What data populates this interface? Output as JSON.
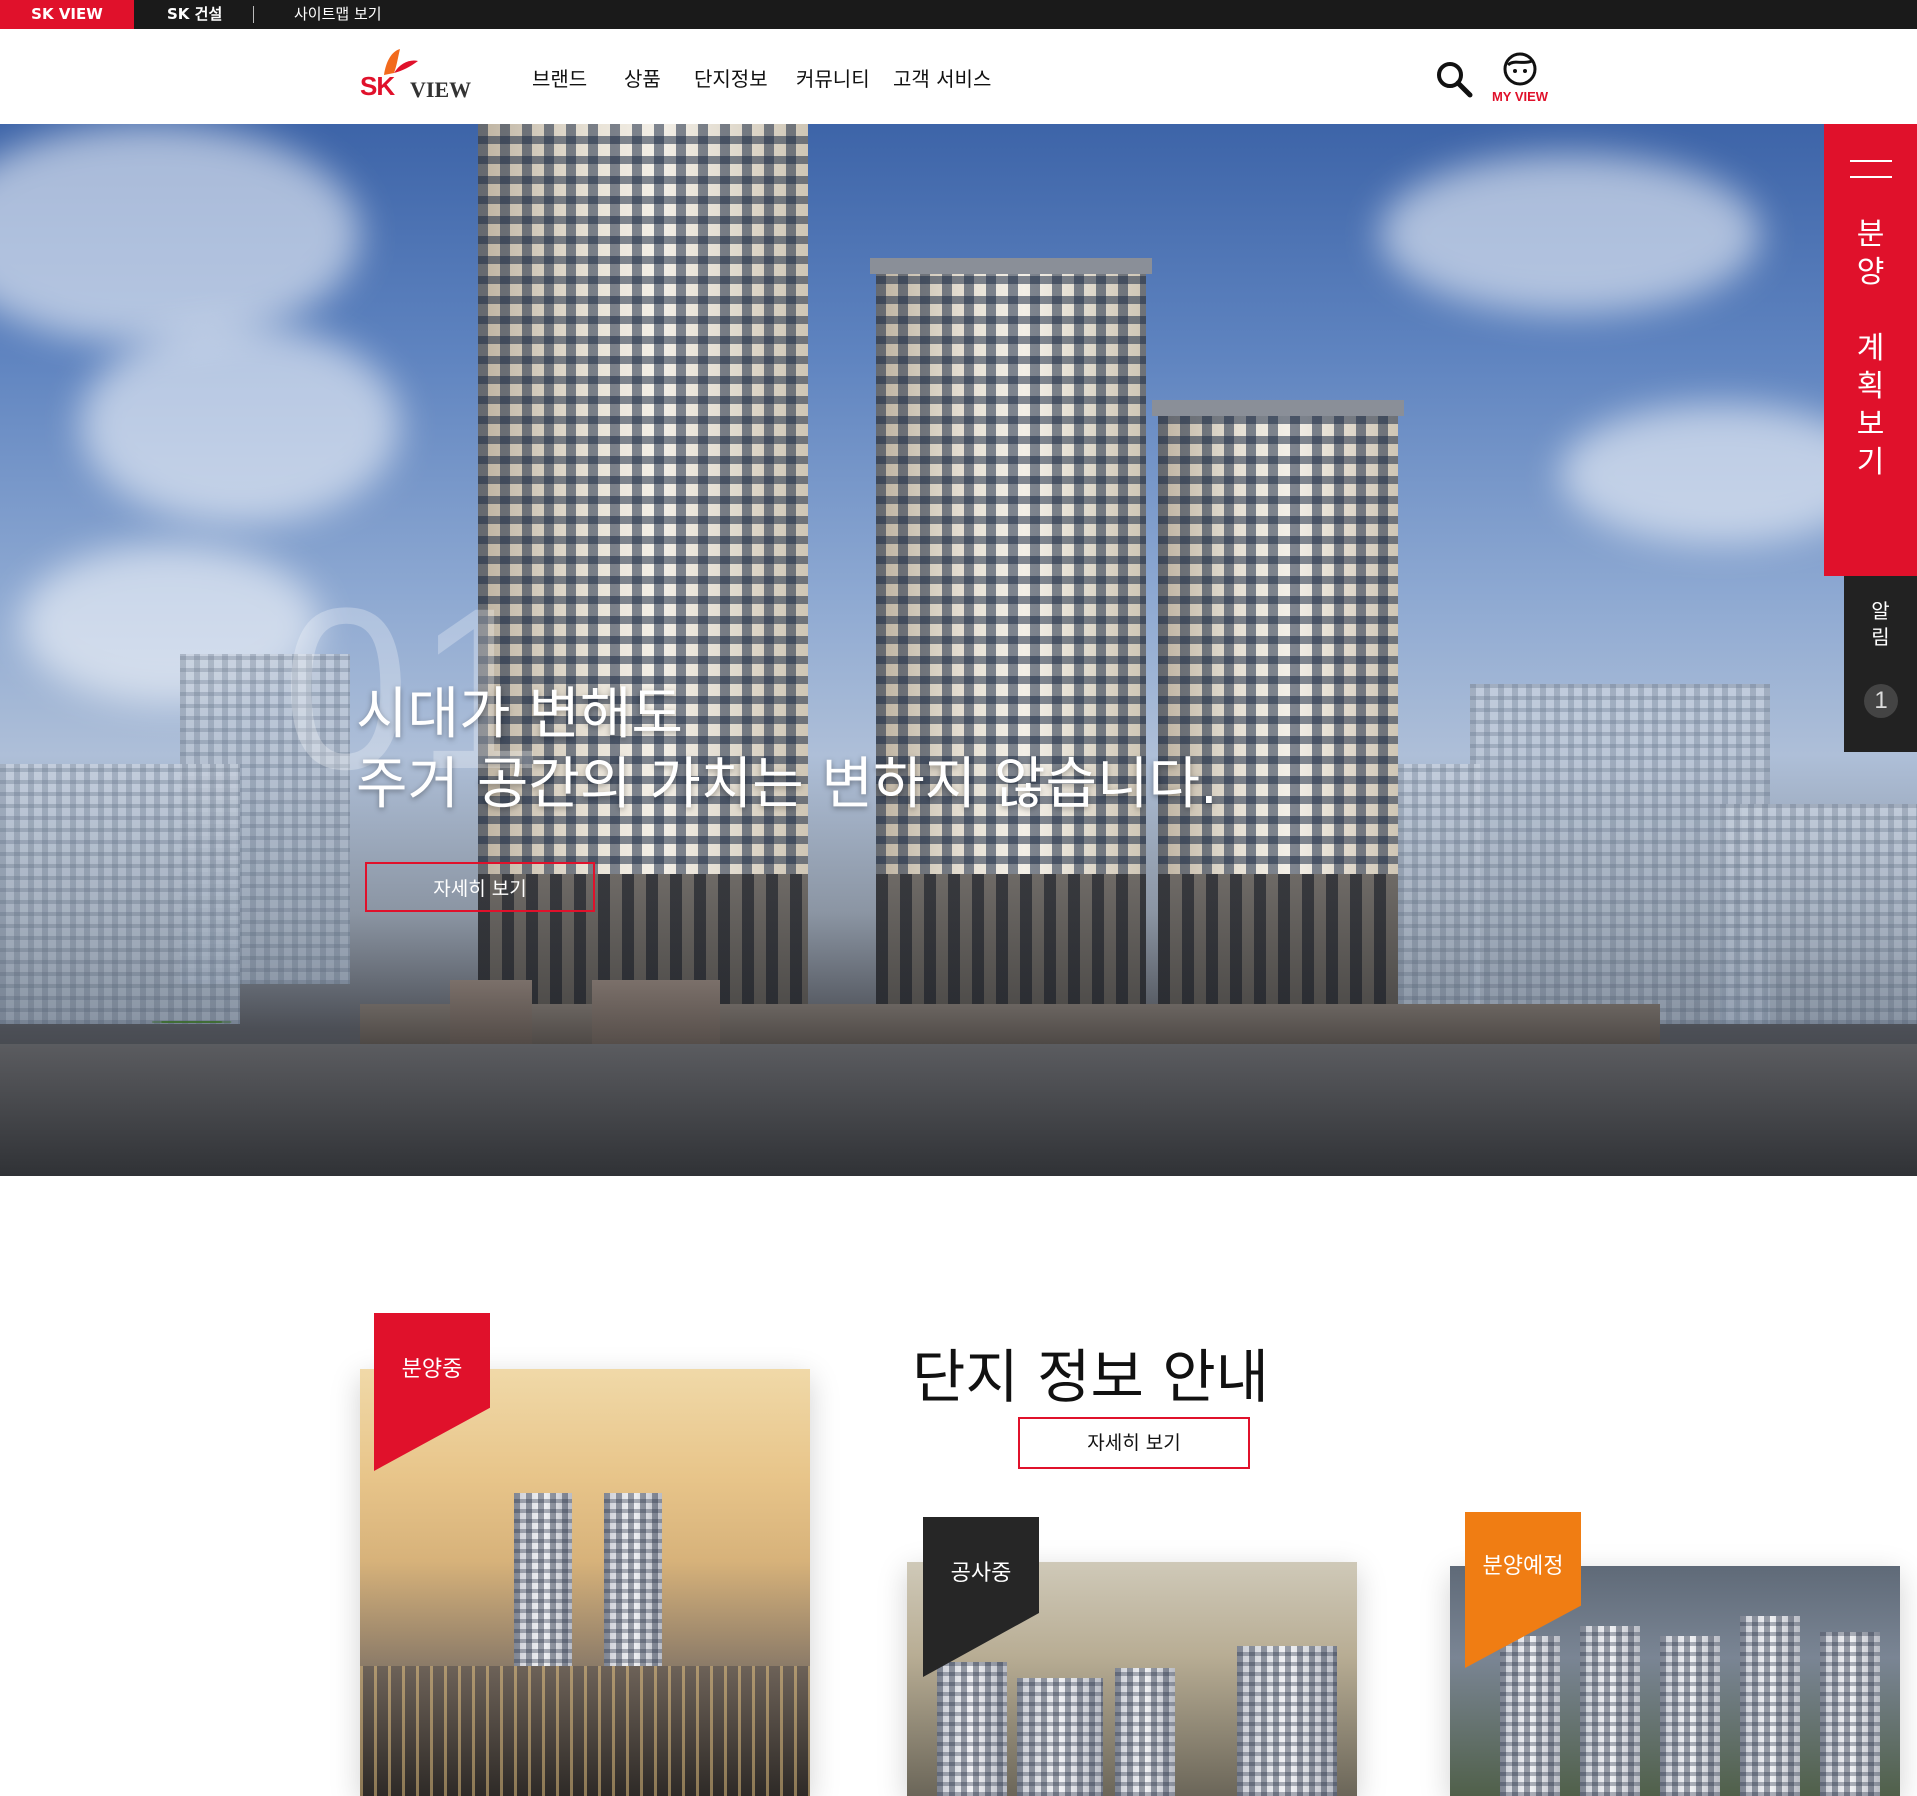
{
  "topbar": {
    "sk_view": "SK VIEW",
    "sk_construction": "SK 건설",
    "sitemap": "사이트맵 보기"
  },
  "header": {
    "logo_sk": "SK",
    "logo_view": "VIEW",
    "nav": [
      "브랜드",
      "상품",
      "단지정보",
      "커뮤니티",
      "고객 서비스"
    ],
    "search_icon": "search-icon",
    "myview_label": "MY VIEW",
    "myview_icon": "face-icon"
  },
  "hero": {
    "slide_number": "01",
    "title_line1": "시대가 변해도",
    "title_line2": "주거 공간의 가치는 변하지 않습니다.",
    "detail_button": "자세히 보기"
  },
  "side": {
    "sales_plan": "분양\n\n계획보기",
    "notice": "알림",
    "notice_count": "1"
  },
  "complex": {
    "title": "단지 정보 안내",
    "detail_button": "자세히 보기",
    "cards": [
      {
        "badge": "분양중"
      },
      {
        "badge": "공사중"
      },
      {
        "badge": "분양예정"
      }
    ]
  },
  "colors": {
    "brand_red": "#e0112b",
    "topbar_black": "#1a1a1a",
    "construction_dark": "#262626",
    "upcoming_orange": "#f07d13"
  }
}
